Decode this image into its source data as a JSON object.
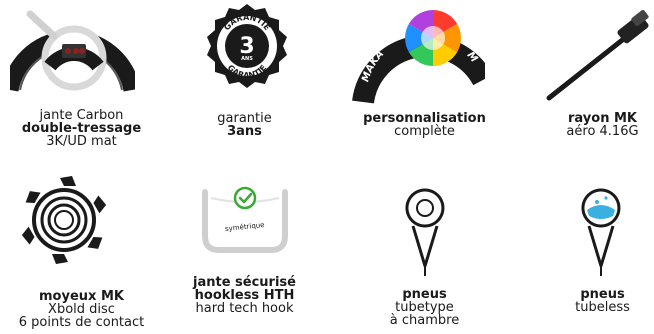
{
  "features": [
    {
      "id": "rim",
      "lines": [
        {
          "text": "jante Carbon",
          "bold": false
        },
        {
          "text": "double-tressage",
          "bold": true
        },
        {
          "text": "3K/UD mat",
          "bold": false
        }
      ]
    },
    {
      "id": "warranty",
      "badge": {
        "top": "GARANTIE",
        "number": "3",
        "unit": "ANS",
        "bottom": "GARANTIE"
      },
      "lines": [
        {
          "text": "garantie",
          "bold": false
        },
        {
          "text": "3ans",
          "bold": true
        }
      ]
    },
    {
      "id": "custom",
      "rim_text": "MAKA",
      "rim_text_end": "M",
      "lines": [
        {
          "text": "personnalisation",
          "bold": true
        },
        {
          "text": "complète",
          "bold": false
        }
      ]
    },
    {
      "id": "spoke",
      "lines": [
        {
          "text": "rayon MK",
          "bold": true
        },
        {
          "text": "aéro 4.16G",
          "bold": false
        }
      ]
    },
    {
      "id": "hub",
      "lines": [
        {
          "text": "moyeux MK",
          "bold": true
        },
        {
          "text": "Xbold disc",
          "bold": false
        },
        {
          "text": "6 points de contact",
          "bold": false
        }
      ]
    },
    {
      "id": "hookless",
      "sym_label": "symétrique",
      "lines": [
        {
          "text": "jante sécurisé",
          "bold": true
        },
        {
          "text": "hookless HTH",
          "bold": true
        },
        {
          "text": "hard tech hook",
          "bold": false
        }
      ]
    },
    {
      "id": "tubetype",
      "lines": [
        {
          "text": "pneus",
          "bold": true
        },
        {
          "text": "tubetype",
          "bold": false
        },
        {
          "text": "à chambre",
          "bold": false
        }
      ]
    },
    {
      "id": "tubeless",
      "lines": [
        {
          "text": "pneus",
          "bold": true
        },
        {
          "text": "tubeless",
          "bold": false
        }
      ]
    }
  ],
  "colors": {
    "ink": "#1a1a1a",
    "check": "#3aaa35",
    "liquid": "#3ab0e0"
  }
}
